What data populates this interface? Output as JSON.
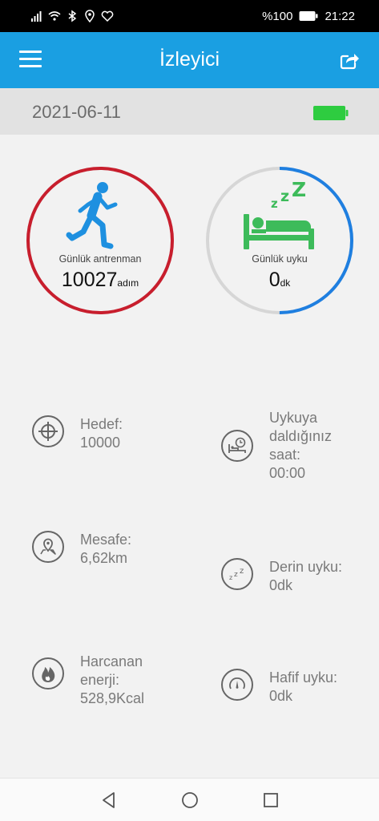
{
  "status_bar": {
    "battery_percent": "%100",
    "time": "21:22"
  },
  "app_bar": {
    "title": "İzleyici"
  },
  "date": "2021-06-11",
  "activity_ring": {
    "label": "Günlük antrenman",
    "value": "10027",
    "unit": "adım",
    "progress": 1.0,
    "color": "#c81e2d"
  },
  "sleep_ring": {
    "label": "Günlük uyku",
    "value": "0",
    "unit": "dk",
    "progress": 0.5,
    "color": "#1f7fe0",
    "track_color": "#d6d6d6"
  },
  "stats": {
    "goal": {
      "label": "Hedef:",
      "value": "10000",
      "icon": "target-icon"
    },
    "distance": {
      "label": "Mesafe:",
      "value": "6,62km",
      "icon": "map-pin-icon"
    },
    "energy": {
      "label_line1": "Harcanan",
      "label_line2": "enerji:",
      "value": "528,9Kcal",
      "icon": "flame-icon"
    },
    "sleep_time": {
      "line1": "Uykuya",
      "line2": "daldığınız",
      "line3": "saat:",
      "value": "00:00",
      "icon": "bed-clock-icon"
    },
    "deep_sleep": {
      "label": "Derin uyku:",
      "value": "0dk",
      "icon": "zzz-icon"
    },
    "light_sleep": {
      "label": "Hafif uyku:",
      "value": "0dk",
      "icon": "gauge-icon"
    }
  },
  "colors": {
    "app_bar": "#1a9fe2",
    "battery": "#2ecc40",
    "runner": "#1e90e0",
    "bed": "#3dbb5a"
  }
}
